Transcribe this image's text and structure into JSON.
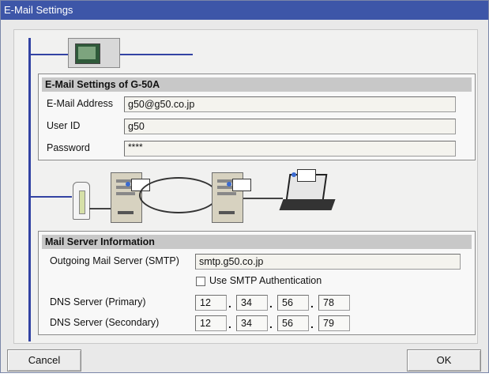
{
  "window": {
    "title": "E-Mail Settings"
  },
  "email_settings": {
    "title": "E-Mail Settings of G-50A",
    "email_label": "E-Mail Address",
    "email_value": "g50@g50.co.jp",
    "userid_label": "User ID",
    "userid_value": "g50",
    "password_label": "Password",
    "password_value": "****"
  },
  "mail_server": {
    "title": "Mail Server Information",
    "smtp_label": "Outgoing Mail Server (SMTP)",
    "smtp_value": "smtp.g50.co.jp",
    "smtp_auth_label": "Use SMTP Authentication",
    "smtp_auth_checked": false,
    "dns_primary_label": "DNS Server (Primary)",
    "dns_primary": [
      "12",
      "34",
      "56",
      "78"
    ],
    "dns_secondary_label": "DNS Server (Secondary)",
    "dns_secondary": [
      "12",
      "34",
      "56",
      "79"
    ]
  },
  "buttons": {
    "cancel": "Cancel",
    "ok": "OK"
  },
  "icons": [
    "controller-device-icon",
    "modem-icon",
    "mail-server-icon",
    "laptop-mail-icon"
  ]
}
